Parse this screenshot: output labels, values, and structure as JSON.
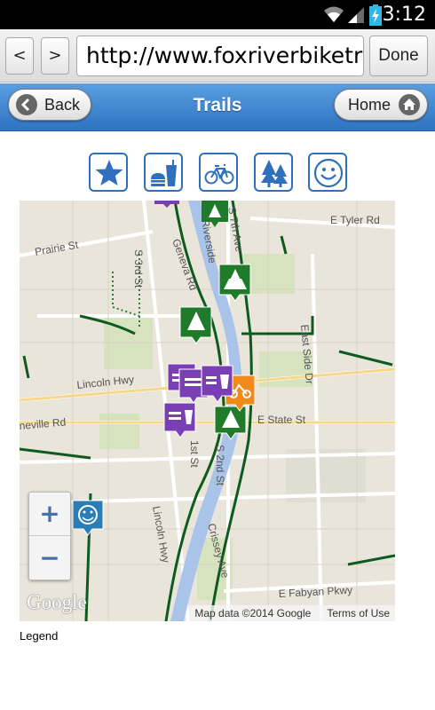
{
  "status_bar": {
    "time": "3:12",
    "icons": [
      "wifi-icon",
      "signal-icon",
      "battery-charging-icon"
    ]
  },
  "browser": {
    "back_label": "<",
    "forward_label": ">",
    "url": "http://www.foxriverbiketrail",
    "done_label": "Done"
  },
  "header": {
    "title": "Trails",
    "back_label": "Back",
    "home_label": "Home"
  },
  "filters": [
    {
      "name": "favorites",
      "icon": "star-icon"
    },
    {
      "name": "food",
      "icon": "burger-drink-icon"
    },
    {
      "name": "bike",
      "icon": "bicycle-icon"
    },
    {
      "name": "parks",
      "icon": "trees-icon"
    },
    {
      "name": "amenities",
      "icon": "smiley-icon"
    }
  ],
  "map": {
    "streets": [
      "E Tyler Rd",
      "Prairie St",
      "Geneva Rd",
      "Riverside",
      "S 7th Ave",
      "S 3rd St",
      "S 2nd St",
      "East Side Dr",
      "Lincoln Hwy",
      "neville Rd",
      "E State St",
      "1st St",
      "Lincoln Hwy",
      "Crissey Ave",
      "E Fabyan Pkwy"
    ],
    "zoom_in": "+",
    "zoom_out": "−",
    "logo": "Google",
    "attribution": "Map data ©2014 Google",
    "terms": "Terms of Use",
    "colors": {
      "water": "#a9c4e8",
      "park": "#c8dfa8",
      "trail": "#0d5a1f",
      "marker_green": "#1f7a2a",
      "marker_purple": "#7b3fb5",
      "marker_orange": "#f08a1a",
      "marker_blue": "#2a7db5"
    }
  },
  "legend": {
    "label": "Legend"
  }
}
